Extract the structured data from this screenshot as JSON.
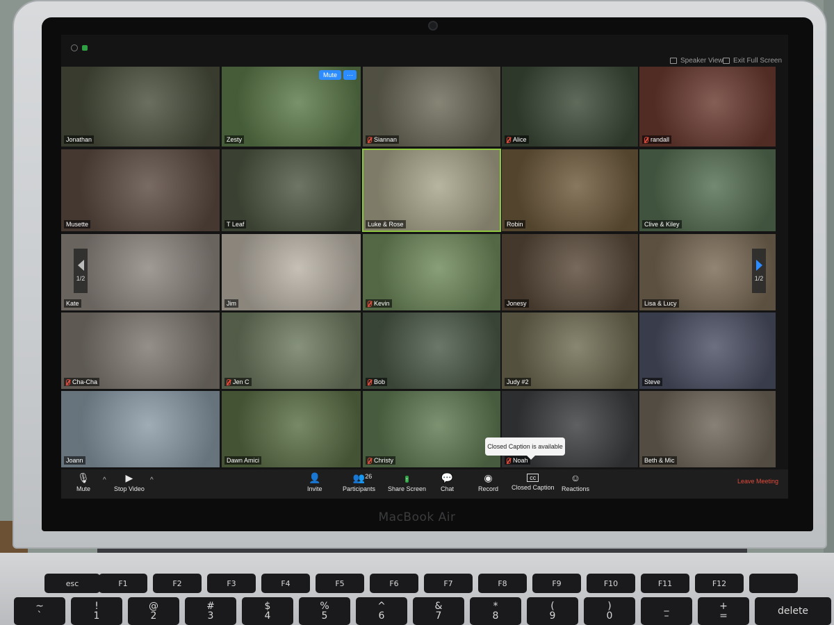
{
  "device": {
    "brand": "MacBook Air"
  },
  "topbar": {
    "speaker_view": "Speaker View",
    "exit_full_screen": "Exit Full Screen"
  },
  "tile_controls": {
    "mute": "Mute",
    "more": "···"
  },
  "pager": {
    "left": "1/2",
    "right": "1/2"
  },
  "participants": [
    {
      "name": "Jonathan",
      "muted": false,
      "bg": "#4a4f3c"
    },
    {
      "name": "Zesty",
      "muted": false,
      "bg": "#5c7a4a"
    },
    {
      "name": "Siannan",
      "muted": true,
      "bg": "#6b6a58"
    },
    {
      "name": "Alice",
      "muted": true,
      "bg": "#3d4a38"
    },
    {
      "name": "randall",
      "muted": true,
      "bg": "#6a3a30"
    },
    {
      "name": "Musette",
      "muted": false,
      "bg": "#5b4b41"
    },
    {
      "name": "T Leaf",
      "muted": false,
      "bg": "#4f5742"
    },
    {
      "name": "Luke & Rose",
      "muted": false,
      "bg": "#a8a48a"
    },
    {
      "name": "Robin",
      "muted": false,
      "bg": "#6e5a3c"
    },
    {
      "name": "Clive & Kiley",
      "muted": false,
      "bg": "#556f52"
    },
    {
      "name": "Kate",
      "muted": false,
      "bg": "#8c857e"
    },
    {
      "name": "Jim",
      "muted": false,
      "bg": "#b9b2a6"
    },
    {
      "name": "Kevin",
      "muted": true,
      "bg": "#6f8a5b"
    },
    {
      "name": "Jonesy",
      "muted": false,
      "bg": "#5a4a3a"
    },
    {
      "name": "Lisa & Lucy",
      "muted": false,
      "bg": "#7a6a55"
    },
    {
      "name": "Cha-Cha",
      "muted": true,
      "bg": "#7d776f"
    },
    {
      "name": "Jen C",
      "muted": true,
      "bg": "#6d7a5f"
    },
    {
      "name": "Bob",
      "muted": true,
      "bg": "#4b5a48"
    },
    {
      "name": "Judy #2",
      "muted": false,
      "bg": "#6f6b52"
    },
    {
      "name": "Steve",
      "muted": false,
      "bg": "#4c5064"
    },
    {
      "name": "Joann",
      "muted": false,
      "bg": "#8a9aa6"
    },
    {
      "name": "Dawn Amici",
      "muted": false,
      "bg": "#5a6f45"
    },
    {
      "name": "Christy",
      "muted": true,
      "bg": "#5f7a52"
    },
    {
      "name": "Noah",
      "muted": true,
      "bg": "#3b3d3f"
    },
    {
      "name": "Beth & Mic",
      "muted": false,
      "bg": "#6e6558"
    }
  ],
  "toast": {
    "text": "Closed Caption is available"
  },
  "toolbar": {
    "mute": "Mute",
    "stop_video": "Stop Video",
    "invite": "Invite",
    "participants": "Participants",
    "participants_count": "26",
    "share_screen": "Share Screen",
    "chat": "Chat",
    "record": "Record",
    "closed_caption": "Closed Caption",
    "cc_glyph": "cc",
    "reactions": "Reactions",
    "leave": "Leave Meeting"
  },
  "keyboard": {
    "row1": [
      "esc",
      "F1",
      "F2",
      "F3",
      "F4",
      "F5",
      "F6",
      "F7",
      "F8",
      "F9",
      "F10",
      "F11",
      "F12",
      ""
    ],
    "row2": [
      "~",
      "!",
      "@",
      "#",
      "$",
      "%",
      "^",
      "&",
      "*",
      "(",
      ")",
      "_",
      "+",
      "delete"
    ],
    "row2_sub": [
      "`",
      "1",
      "2",
      "3",
      "4",
      "5",
      "6",
      "7",
      "8",
      "9",
      "0",
      "–",
      "=",
      ""
    ]
  }
}
